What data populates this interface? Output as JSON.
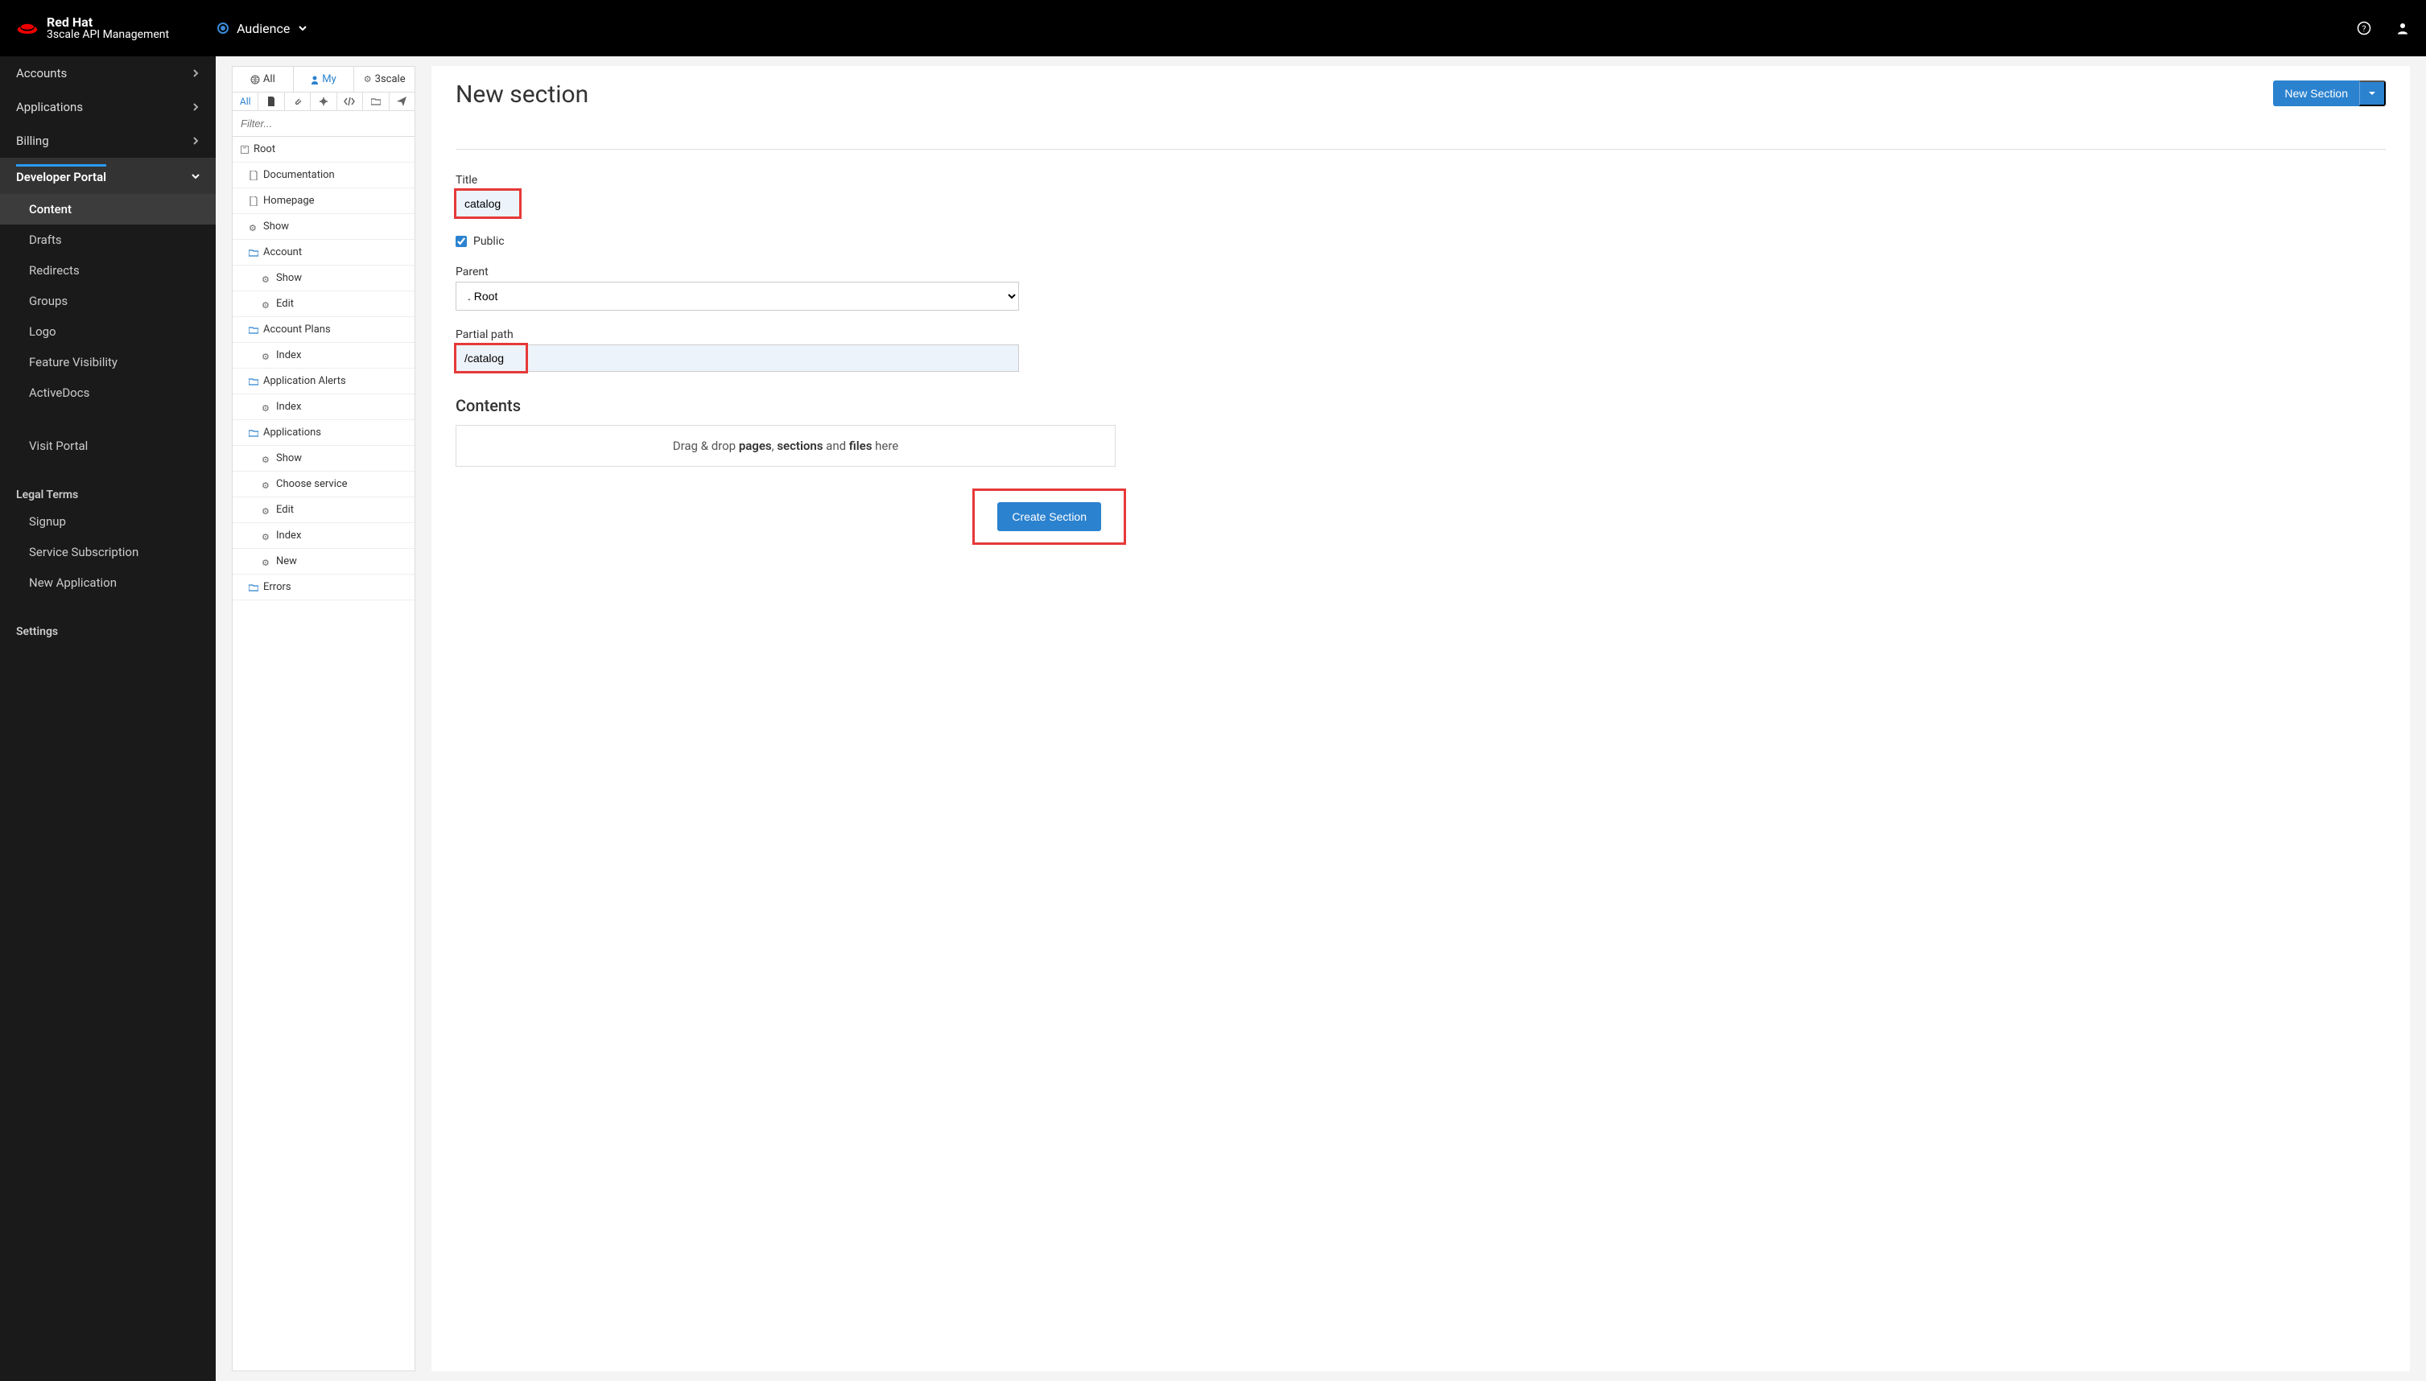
{
  "brand": {
    "name": "Red Hat",
    "product": "3scale API Management"
  },
  "context": {
    "label": "Audience"
  },
  "sidebar": {
    "items": [
      {
        "label": "Accounts",
        "expandable": true
      },
      {
        "label": "Applications",
        "expandable": true
      },
      {
        "label": "Billing",
        "expandable": true
      },
      {
        "label": "Developer Portal",
        "expandable": true,
        "active": true,
        "children": [
          {
            "label": "Content",
            "active": true
          },
          {
            "label": "Drafts"
          },
          {
            "label": "Redirects"
          },
          {
            "label": "Groups"
          },
          {
            "label": "Logo"
          },
          {
            "label": "Feature Visibility"
          },
          {
            "label": "ActiveDocs"
          },
          {
            "label": "Visit Portal"
          }
        ]
      }
    ],
    "legal_header": "Legal Terms",
    "legal": [
      {
        "label": "Signup"
      },
      {
        "label": "Service Subscription"
      },
      {
        "label": "New Application"
      }
    ],
    "settings_header": "Settings"
  },
  "tree_tabs": {
    "all": "All",
    "my": "My",
    "threescale": "3scale"
  },
  "filter_icons": {
    "all": "All"
  },
  "filter_placeholder": "Filter...",
  "tree": {
    "root": "Root",
    "nodes": [
      {
        "label": "Documentation",
        "type": "page",
        "depth": 1
      },
      {
        "label": "Homepage",
        "type": "page",
        "depth": 1
      },
      {
        "label": "Show",
        "type": "gear",
        "depth": 1
      },
      {
        "label": "Account",
        "type": "folder",
        "depth": 1
      },
      {
        "label": "Show",
        "type": "gear",
        "depth": 2
      },
      {
        "label": "Edit",
        "type": "gear",
        "depth": 2
      },
      {
        "label": "Account Plans",
        "type": "folder",
        "depth": 1
      },
      {
        "label": "Index",
        "type": "gear",
        "depth": 2
      },
      {
        "label": "Application Alerts",
        "type": "folder",
        "depth": 1
      },
      {
        "label": "Index",
        "type": "gear",
        "depth": 2
      },
      {
        "label": "Applications",
        "type": "folder",
        "depth": 1
      },
      {
        "label": "Show",
        "type": "gear",
        "depth": 2
      },
      {
        "label": "Choose service",
        "type": "gear",
        "depth": 2
      },
      {
        "label": "Edit",
        "type": "gear",
        "depth": 2
      },
      {
        "label": "Index",
        "type": "gear",
        "depth": 2
      },
      {
        "label": "New",
        "type": "gear",
        "depth": 2
      },
      {
        "label": "Errors",
        "type": "folder",
        "depth": 1
      }
    ]
  },
  "main": {
    "title": "New section",
    "new_section_btn": "New Section",
    "form": {
      "title_label": "Title",
      "title_value": "catalog",
      "public_label": "Public",
      "public_checked": true,
      "parent_label": "Parent",
      "parent_value": ". Root",
      "path_label": "Partial path",
      "path_value": "/catalog"
    },
    "contents_heading": "Contents",
    "drop_prefix": "Drag & drop ",
    "drop_pages": "pages",
    "drop_sep1": ", ",
    "drop_sections": "sections",
    "drop_and": " and ",
    "drop_files": "files",
    "drop_suffix": " here",
    "create_btn": "Create Section"
  }
}
